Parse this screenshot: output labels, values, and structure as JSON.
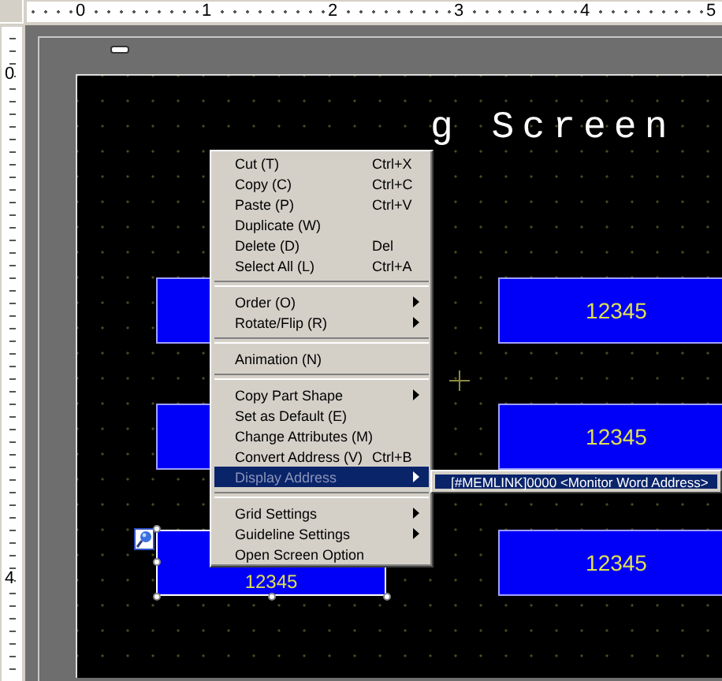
{
  "rulers": {
    "top_labels": [
      "0",
      "1",
      "2",
      "3",
      "4",
      "5"
    ],
    "left_labels": [
      "0",
      "4"
    ]
  },
  "screen": {
    "title": "g Screen",
    "parts": [
      {
        "selected": false
      },
      {
        "label": "12345",
        "selected": false
      },
      {
        "selected": false
      },
      {
        "label": "12345",
        "selected": false
      },
      {
        "label": "12345",
        "selected": true
      },
      {
        "label": "12345",
        "selected": false
      }
    ]
  },
  "context_menu": {
    "items": [
      {
        "kind": "item",
        "label": "Cut (T)",
        "shortcut": "Ctrl+X",
        "submenu": false,
        "selected": false
      },
      {
        "kind": "item",
        "label": "Copy (C)",
        "shortcut": "Ctrl+C",
        "submenu": false,
        "selected": false
      },
      {
        "kind": "item",
        "label": "Paste (P)",
        "shortcut": "Ctrl+V",
        "submenu": false,
        "selected": false
      },
      {
        "kind": "item",
        "label": "Duplicate (W)",
        "submenu": false,
        "selected": false
      },
      {
        "kind": "item",
        "label": "Delete (D)",
        "shortcut": "Del",
        "submenu": false,
        "selected": false
      },
      {
        "kind": "item",
        "label": "Select All (L)",
        "shortcut": "Ctrl+A",
        "submenu": false,
        "selected": false
      },
      {
        "kind": "separator"
      },
      {
        "kind": "item",
        "label": "Order (O)",
        "submenu": true,
        "selected": false
      },
      {
        "kind": "item",
        "label": "Rotate/Flip (R)",
        "submenu": true,
        "selected": false
      },
      {
        "kind": "separator"
      },
      {
        "kind": "item",
        "label": "Animation (N)",
        "submenu": false,
        "selected": false
      },
      {
        "kind": "separator"
      },
      {
        "kind": "item",
        "label": "Copy Part Shape",
        "submenu": true,
        "selected": false
      },
      {
        "kind": "item",
        "label": "Set as Default (E)",
        "submenu": false,
        "selected": false
      },
      {
        "kind": "item",
        "label": "Change Attributes (M)",
        "submenu": false,
        "selected": false
      },
      {
        "kind": "item",
        "label": "Convert Address (V)",
        "shortcut": "Ctrl+B",
        "submenu": false,
        "selected": false
      },
      {
        "kind": "item",
        "label": "Display Address",
        "submenu": true,
        "selected": true
      },
      {
        "kind": "separator"
      },
      {
        "kind": "item",
        "label": "Grid Settings",
        "submenu": true,
        "selected": false
      },
      {
        "kind": "item",
        "label": "Guideline Settings",
        "submenu": true,
        "selected": false
      },
      {
        "kind": "item",
        "label": "Open Screen Option",
        "submenu": false,
        "selected": false
      }
    ]
  },
  "submenu": {
    "items": [
      {
        "label": "[#MEMLINK]0000 <Monitor Word Address>",
        "selected": true
      }
    ]
  }
}
